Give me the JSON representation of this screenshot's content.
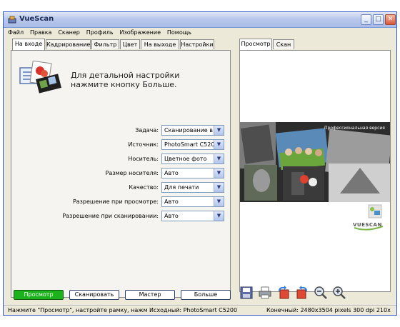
{
  "window": {
    "title": "VueScan",
    "controls": {
      "minimize": "_",
      "maximize": "□",
      "close": "✕"
    }
  },
  "menu": [
    "Файл",
    "Правка",
    "Сканер",
    "Профиль",
    "Изображение",
    "Помощь"
  ],
  "tabs": [
    "На входе",
    "Кадрирование",
    "Фильтр",
    "Цвет",
    "На выходе",
    "Настройки"
  ],
  "active_tab": "На входе",
  "info": {
    "line1": "Для детальной настройки",
    "line2": "нажмите кнопку Больше."
  },
  "fields": [
    {
      "label": "Задача:",
      "value": "Сканирование в ф"
    },
    {
      "label": "Источник:",
      "value": "PhotoSmart C5200"
    },
    {
      "label": "Носитель:",
      "value": "Цветное фото"
    },
    {
      "label": "Размер носителя:",
      "value": "Авто"
    },
    {
      "label": "Качество:",
      "value": "Для печати"
    },
    {
      "label": "Разрешение при просмотре:",
      "value": "Авто"
    },
    {
      "label": "Разрешение при сканировании:",
      "value": "Авто"
    }
  ],
  "buttons": {
    "preview": "Просмотр",
    "scan": "Сканировать",
    "wizard": "Мастер",
    "more": "Больше"
  },
  "right_tabs": [
    "Просмотр",
    "Скан"
  ],
  "preview_banner_text": "Профессиональная версия",
  "logo_text": "VUESCAN",
  "toolbar_icons": [
    "save-icon",
    "print-icon",
    "rotate-left-icon",
    "rotate-right-icon",
    "zoom-out-icon",
    "zoom-in-icon"
  ],
  "status": {
    "left": "Нажмите \"Просмотр\", настройте рамку, нажм Исходный: PhotoSmart C5200",
    "right": "Конечный: 2480x3504 pixels 300 dpi 210x"
  },
  "colors": {
    "accent": "#1bb21b",
    "title_bar": "#b9c8ec",
    "window_border": "#2c56c7"
  }
}
